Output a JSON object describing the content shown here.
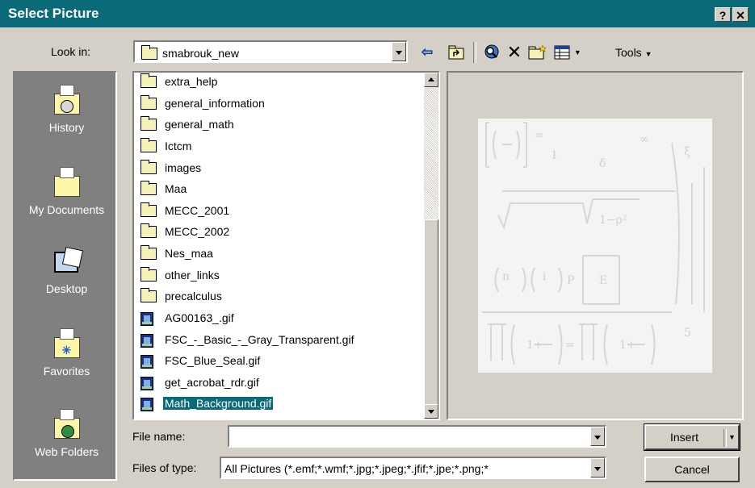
{
  "dialog": {
    "title": "Select Picture",
    "help_glyph": "?",
    "close_glyph": "✕"
  },
  "look_in": {
    "label": "Look in:",
    "value": "smabrouk_new"
  },
  "toolbar": {
    "back_glyph": "⇦",
    "up_glyph": "⮤",
    "delete_glyph": "✕",
    "tools_label": "Tools"
  },
  "places": [
    {
      "label": "History",
      "icon": "history-icon"
    },
    {
      "label": "My Documents",
      "icon": "my-documents-icon"
    },
    {
      "label": "Desktop",
      "icon": "desktop-icon"
    },
    {
      "label": "Favorites",
      "icon": "favorites-icon"
    },
    {
      "label": "Web Folders",
      "icon": "web-folders-icon"
    }
  ],
  "files": [
    {
      "name": "extra_help",
      "type": "folder"
    },
    {
      "name": "general_information",
      "type": "folder"
    },
    {
      "name": "general_math",
      "type": "folder"
    },
    {
      "name": "Ictcm",
      "type": "folder"
    },
    {
      "name": "images",
      "type": "folder"
    },
    {
      "name": "Maa",
      "type": "folder"
    },
    {
      "name": "MECC_2001",
      "type": "folder"
    },
    {
      "name": "MECC_2002",
      "type": "folder"
    },
    {
      "name": "Nes_maa",
      "type": "folder"
    },
    {
      "name": "other_links",
      "type": "folder"
    },
    {
      "name": "precalculus",
      "type": "folder"
    },
    {
      "name": "AG00163_.gif",
      "type": "gif"
    },
    {
      "name": "FSC_-_Basic_-_Gray_Transparent.gif",
      "type": "gif"
    },
    {
      "name": "FSC_Blue_Seal.gif",
      "type": "gif"
    },
    {
      "name": "get_acrobat_rdr.gif",
      "type": "gif"
    },
    {
      "name": "Math_Background.gif",
      "type": "gif",
      "selected": true
    }
  ],
  "file_name": {
    "label": "File name:",
    "value": ""
  },
  "files_of_type": {
    "label": "Files of type:",
    "value": "All Pictures (*.emf;*.wmf;*.jpg;*.jpeg;*.jfif;*.jpe;*.png;*"
  },
  "buttons": {
    "insert": "Insert",
    "cancel": "Cancel"
  },
  "colors": {
    "titlebar": "#0a6a78",
    "selection": "#0a6a78",
    "face": "#d4d0c8",
    "places": "#808080"
  }
}
